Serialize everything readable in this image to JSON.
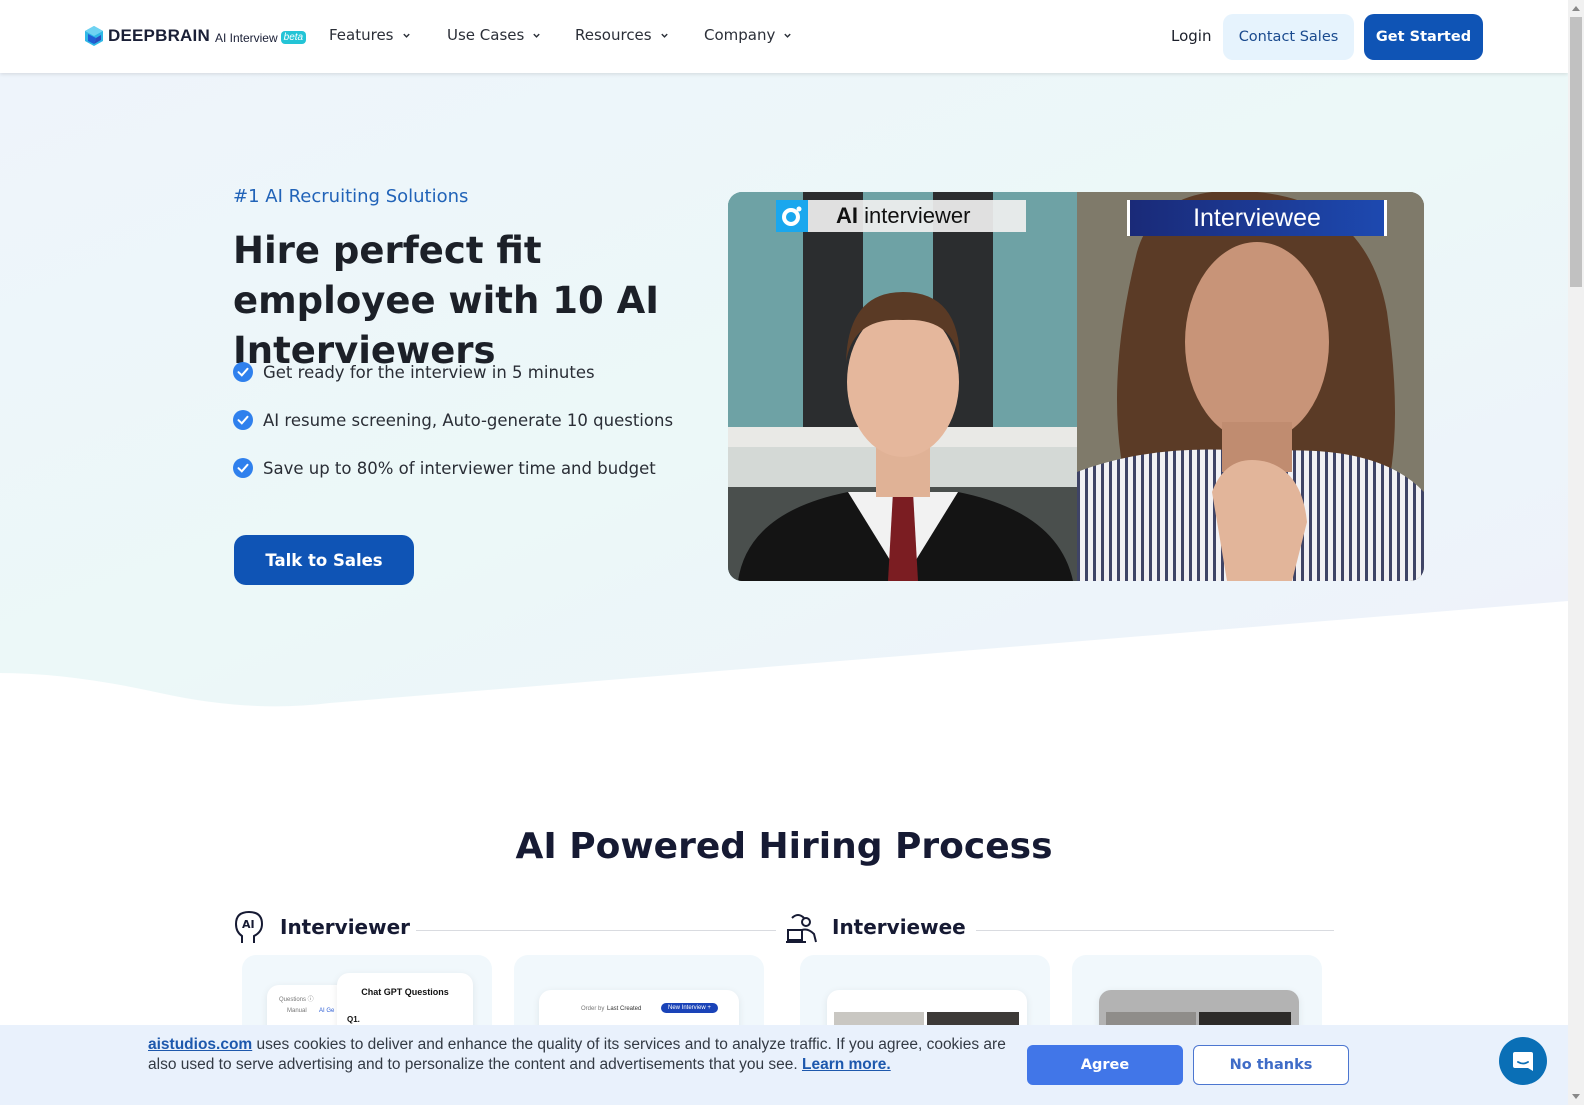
{
  "header": {
    "logo": {
      "brand": "DEEPBRAIN",
      "product": "AI Interview",
      "badge": "beta"
    },
    "nav": [
      {
        "label": "Features",
        "icon": "chevron-down-icon"
      },
      {
        "label": "Use Cases",
        "icon": "chevron-down-icon"
      },
      {
        "label": "Resources",
        "icon": "chevron-down-icon"
      },
      {
        "label": "Company",
        "icon": "chevron-down-icon"
      }
    ],
    "login": "Login",
    "contact_sales": "Contact Sales",
    "get_started": "Get Started"
  },
  "hero": {
    "eyebrow": "#1 AI Recruiting Solutions",
    "title": "Hire perfect fit employee with 10 AI Interviewers",
    "bullets": [
      "Get ready for the interview in 5 minutes",
      "AI resume screening, Auto-generate 10 questions",
      "Save up to 80% of interviewer time and budget"
    ],
    "cta": "Talk to Sales",
    "video": {
      "left_label_bold": "AI",
      "left_label_rest": " interviewer",
      "right_label": "Interviewee"
    }
  },
  "process": {
    "title": "AI Powered Hiring Process",
    "categories": [
      {
        "label": "Interviewer",
        "icon": "ai-head-icon"
      },
      {
        "label": "Interviewee",
        "icon": "person-laptop-icon"
      }
    ],
    "cards": [
      {
        "questions_label": "Questions ⓘ",
        "option_manual": "Manual",
        "option_ai": "AI Ge",
        "popup_title": "Chat GPT Questions",
        "q_label": "Q1."
      },
      {
        "order_label": "Order by",
        "order_value": "Last Created",
        "new_button": "New Interview +"
      },
      {
        "type": "interview-preview"
      },
      {
        "type": "interview-preview-dimmed"
      }
    ]
  },
  "cookie": {
    "link": "aistudios.com",
    "text": " uses cookies to deliver and enhance the quality of its services and to analyze traffic. If you agree, cookies are also used to serve advertising and to personalize the content and advertisements that you see. ",
    "learn_more": "Learn more.",
    "agree": "Agree",
    "no_thanks": "No thanks"
  },
  "colors": {
    "primary": "#0f54b5",
    "accent_light": "#e6f3fd",
    "eyebrow": "#2163b8",
    "check": "#2f80ed",
    "agree": "#4176e8",
    "chat": "#0a6fb6"
  }
}
